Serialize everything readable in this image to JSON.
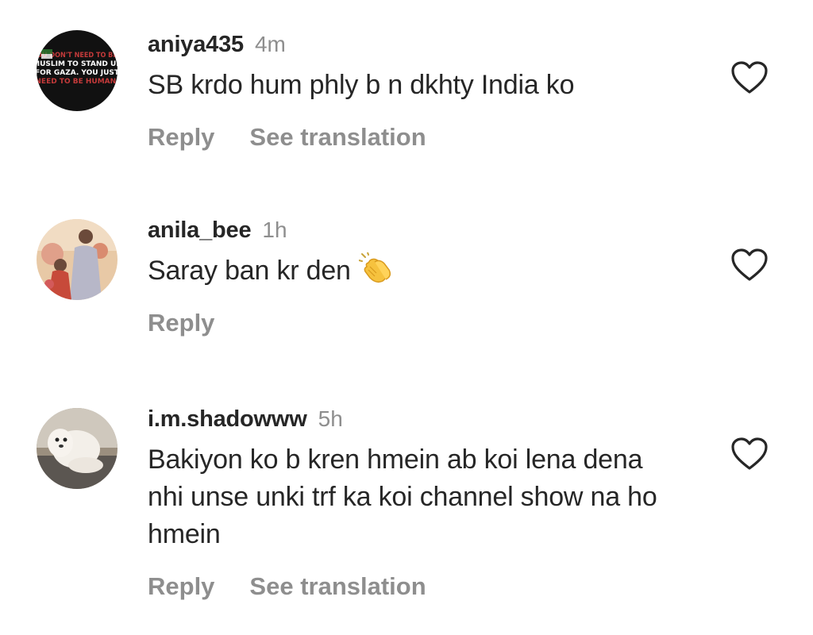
{
  "comments": [
    {
      "username": "aniya435",
      "time": "4m",
      "text": "SB krdo hum phly b n dkhty India ko",
      "reply_label": "Reply",
      "translation_label": "See translation",
      "avatar_text": [
        "OU DON'T NEED TO BE",
        "MUSLIM TO STAND UP",
        "FOR GAZA. YOU JUST",
        "NEED TO BE HUMAN."
      ],
      "avatar_color": "#111111"
    },
    {
      "username": "anila_bee",
      "time": "1h",
      "text": "Saray ban kr den",
      "emoji": "clapping-hands",
      "reply_label": "Reply"
    },
    {
      "username": "i.m.shadowww",
      "time": "5h",
      "text": "Bakiyon ko b kren hmein ab koi lena dena nhi unse unki trf ka koi channel show na ho hmein",
      "reply_label": "Reply",
      "translation_label": "See translation"
    }
  ],
  "colors": {
    "primary_text": "#262626",
    "secondary_text": "#8e8e8e",
    "heart_outline": "#262626",
    "background": "#ffffff"
  }
}
